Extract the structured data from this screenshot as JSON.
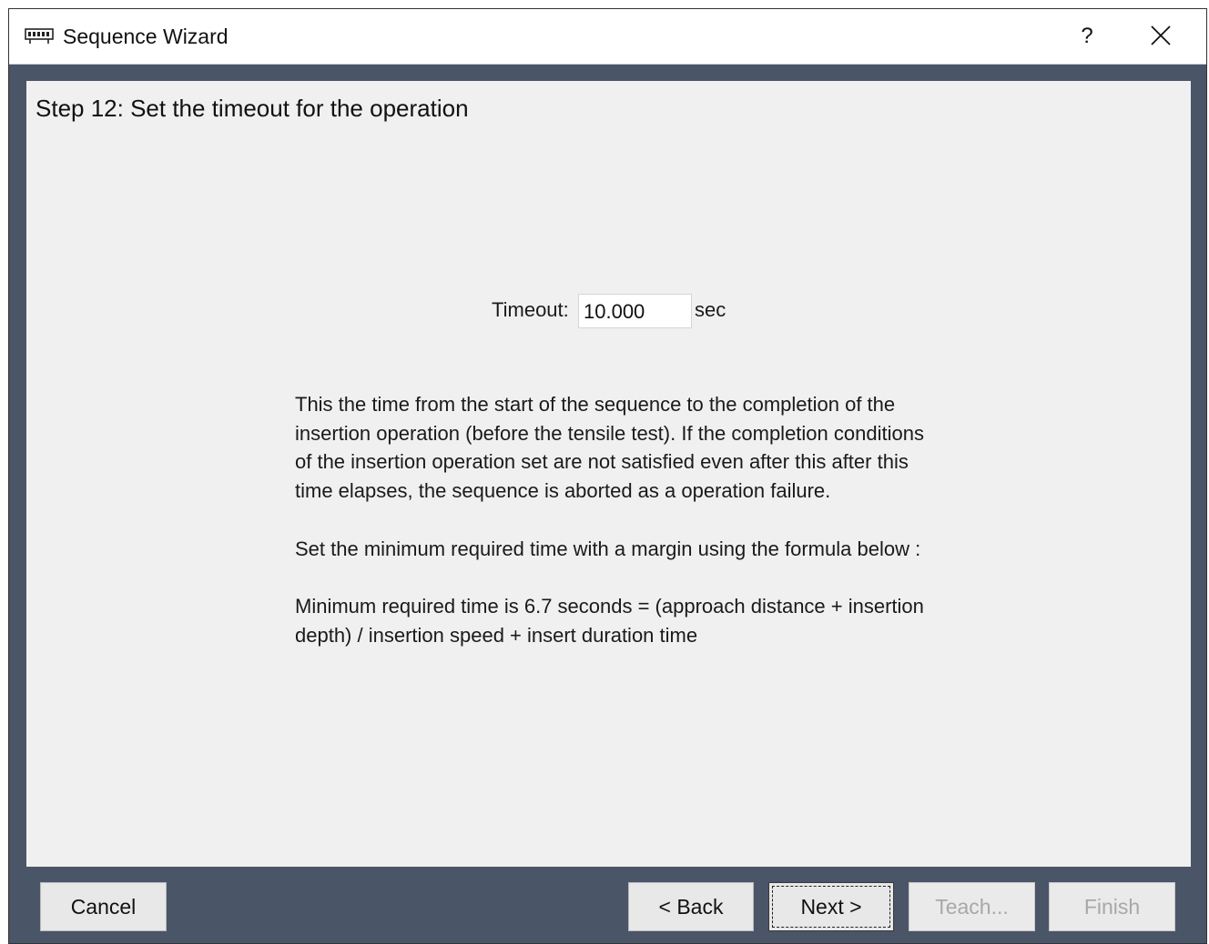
{
  "window": {
    "title": "Sequence Wizard",
    "help_label": "?"
  },
  "step": {
    "title": "Step 12: Set the timeout for the operation"
  },
  "timeout": {
    "label": "Timeout:",
    "value": "10.000",
    "unit": "sec"
  },
  "description": {
    "paragraphs": [
      "This the time from the start of the sequence to the completion of the insertion operation (before the tensile test).  If the completion conditions of the insertion operation set are not satisfied even after this after this time elapses, the sequence is aborted as a operation failure.",
      "Set the minimum required time with a margin using the formula below :",
      "Minimum required time is 6.7 seconds = (approach distance + insertion depth) / insertion speed + insert duration time"
    ]
  },
  "buttons": {
    "cancel": "Cancel",
    "back": "< Back",
    "next": "Next >",
    "teach": "Teach...",
    "finish": "Finish"
  },
  "icons": {
    "app": "wizard-app-icon",
    "close": "close-icon"
  },
  "colors": {
    "frame": "#4a5568",
    "panel": "#f0f0f0",
    "button": "#e8e8e8",
    "disabled_text": "#a8a8a8"
  }
}
